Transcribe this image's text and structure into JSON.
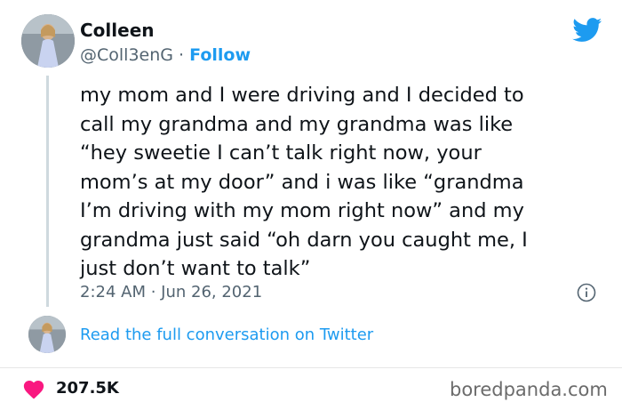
{
  "author": {
    "name": "Colleen",
    "handle": "@Coll3enG",
    "separator": "·",
    "follow_label": "Follow"
  },
  "tweet": {
    "text": "my mom and I were driving and I decided to\ncall my grandma and my grandma was like\n“hey sweetie I can’t talk right now, your\nmom’s at my door” and i was like “grandma\nI’m driving with my mom right now” and my\ngrandma just said “oh darn you caught me, I\njust don’t want to talk”",
    "timestamp": "2:24 AM · Jun 26, 2021"
  },
  "conversation_link": "Read the full conversation on Twitter",
  "likes": {
    "count": "207.5K",
    "icon": "heart-icon"
  },
  "watermark": "boredpanda.com",
  "icons": {
    "logo": "twitter-bird-icon",
    "info": "info-icon"
  },
  "colors": {
    "accent": "#1d9bf0",
    "heart": "#f91880",
    "muted": "#536471",
    "text": "#0f1419"
  }
}
